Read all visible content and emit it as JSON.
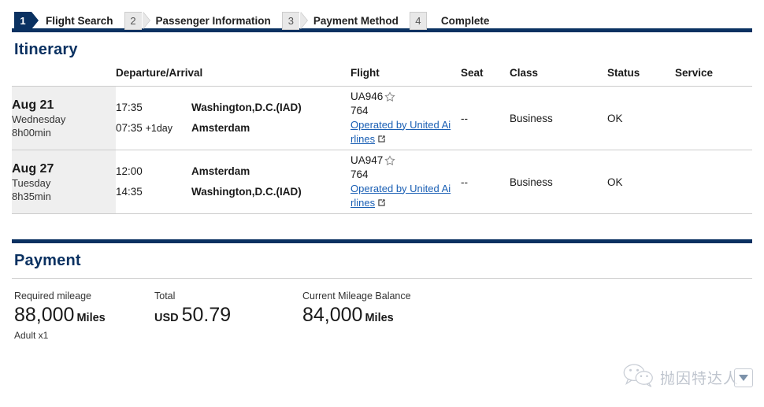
{
  "stepper": {
    "steps": [
      {
        "num": "1",
        "label": "Flight Search",
        "state": "active"
      },
      {
        "num": "2",
        "label": "Passenger Information",
        "state": "inactive"
      },
      {
        "num": "3",
        "label": "Payment Method",
        "state": "inactive"
      },
      {
        "num": "4",
        "label": "Complete",
        "state": "inactive"
      }
    ]
  },
  "itinerary": {
    "title": "Itinerary",
    "columns": {
      "date": "",
      "departure_arrival": "Departure/Arrival",
      "flight": "Flight",
      "seat": "Seat",
      "class": "Class",
      "status": "Status",
      "service": "Service"
    },
    "rows": [
      {
        "date": "Aug 21",
        "weekday": "Wednesday",
        "duration": "8h00min",
        "dep_time": "17:35",
        "dep_place": "Washington,D.C.(IAD)",
        "arr_time": "07:35",
        "arr_day_offset": "+1day",
        "arr_place": "Amsterdam",
        "flight_no": "UA946",
        "equipment": "764",
        "operated_by": "Operated by United Airlines",
        "seat": "--",
        "class": "Business",
        "status": "OK",
        "service": ""
      },
      {
        "date": "Aug 27",
        "weekday": "Tuesday",
        "duration": "8h35min",
        "dep_time": "12:00",
        "dep_place": "Amsterdam",
        "arr_time": "14:35",
        "arr_day_offset": "",
        "arr_place": "Washington,D.C.(IAD)",
        "flight_no": "UA947",
        "equipment": "764",
        "operated_by": "Operated by United Airlines",
        "seat": "--",
        "class": "Business",
        "status": "OK",
        "service": ""
      }
    ]
  },
  "payment": {
    "title": "Payment",
    "required_mileage": {
      "label": "Required mileage",
      "value": "88,000",
      "unit": "Miles",
      "note": "Adult x1"
    },
    "total": {
      "label": "Total",
      "currency": "USD",
      "value": "50.79"
    },
    "current_balance": {
      "label": "Current Mileage Balance",
      "value": "84,000",
      "unit": "Miles"
    }
  },
  "watermark": {
    "text": "抛因特达人"
  },
  "colors": {
    "navy": "#0a3161",
    "link": "#1a5fb4",
    "row_gray": "#efefef",
    "border_gray": "#cccccc"
  }
}
